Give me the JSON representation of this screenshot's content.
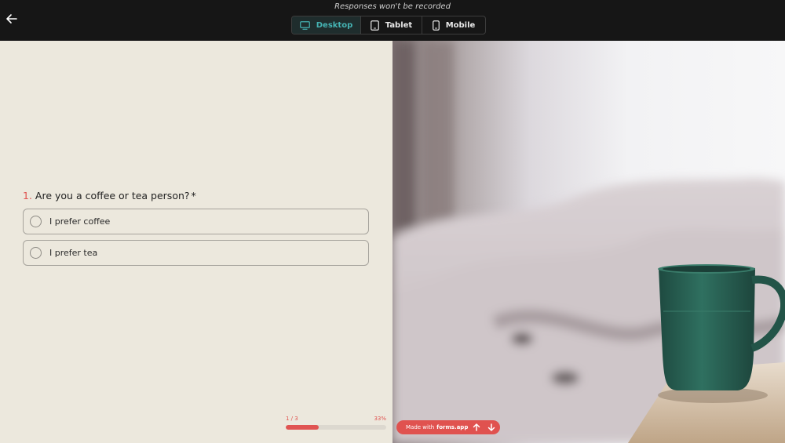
{
  "topbar": {
    "notice": "Responses won't be recorded",
    "devices": [
      {
        "label": "Desktop",
        "icon": "desktop-icon",
        "active": true
      },
      {
        "label": "Tablet",
        "icon": "tablet-icon",
        "active": false
      },
      {
        "label": "Mobile",
        "icon": "mobile-icon",
        "active": false
      }
    ]
  },
  "form": {
    "question": {
      "number": "1.",
      "text": "Are you a coffee or tea person?",
      "required_mark": "*"
    },
    "options": [
      {
        "label": "I prefer coffee"
      },
      {
        "label": "I prefer tea"
      }
    ],
    "progress": {
      "step": "1 / 3",
      "percent_label": "33%",
      "fraction": 0.33
    }
  },
  "branding": {
    "prefix": "Made with",
    "name": "forms.app"
  },
  "colors": {
    "accent": "#e0524f",
    "active_tab": "#45b3b3",
    "panel_bg": "#ece8dd",
    "mug": "#2f7060"
  }
}
